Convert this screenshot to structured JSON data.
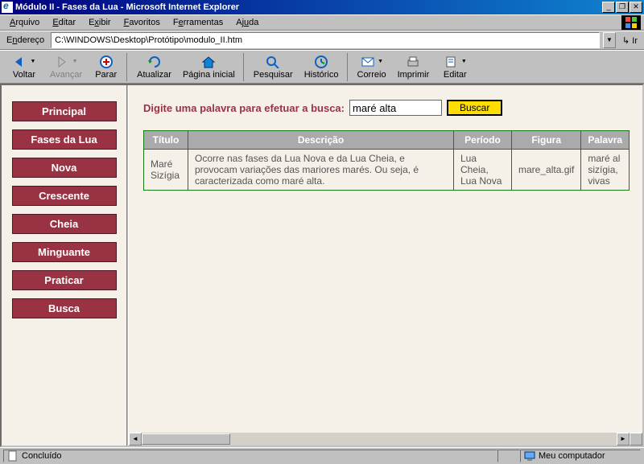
{
  "window": {
    "title": "Módulo II - Fases da Lua - Microsoft Internet Explorer"
  },
  "win_buttons": {
    "minimize": "_",
    "restore": "❐",
    "close": "✕"
  },
  "menu": {
    "arquivo": "Arquivo",
    "editar": "Editar",
    "exibir": "Exibir",
    "favoritos": "Favoritos",
    "ferramentas": "Ferramentas",
    "ajuda": "Ajuda"
  },
  "address": {
    "label": "Endereço",
    "value": "C:\\WINDOWS\\Desktop\\Protótipo\\modulo_II.htm",
    "go": "Ir"
  },
  "toolbar": {
    "voltar": "Voltar",
    "avancar": "Avançar",
    "parar": "Parar",
    "atualizar": "Atualizar",
    "inicial": "Página inicial",
    "pesquisar": "Pesquisar",
    "historico": "Histórico",
    "correio": "Correio",
    "imprimir": "Imprimir",
    "editar_btn": "Editar"
  },
  "sidebar": {
    "items": [
      {
        "label": "Principal"
      },
      {
        "label": "Fases da Lua"
      },
      {
        "label": "Nova"
      },
      {
        "label": "Crescente"
      },
      {
        "label": "Cheia"
      },
      {
        "label": "Minguante"
      },
      {
        "label": "Praticar"
      },
      {
        "label": "Busca"
      }
    ]
  },
  "search": {
    "label": "Digite uma palavra para efetuar a busca:",
    "value": "maré alta",
    "button": "Buscar"
  },
  "table": {
    "headers": {
      "titulo": "Título",
      "descricao": "Descrição",
      "periodo": "Período",
      "figura": "Figura",
      "palavra": "Palavra"
    },
    "row": {
      "titulo": "Maré Sizígia",
      "descricao": "Ocorre nas fases da Lua Nova e da Lua Cheia, e provocam variações das mariores marés. Ou seja, é caracterizada como maré alta.",
      "periodo": "Lua Cheia, Lua Nova",
      "figura": "mare_alta.gif",
      "palavra": "maré al sizígia, vivas"
    }
  },
  "status": {
    "left": "Concluído",
    "right": "Meu computador"
  }
}
